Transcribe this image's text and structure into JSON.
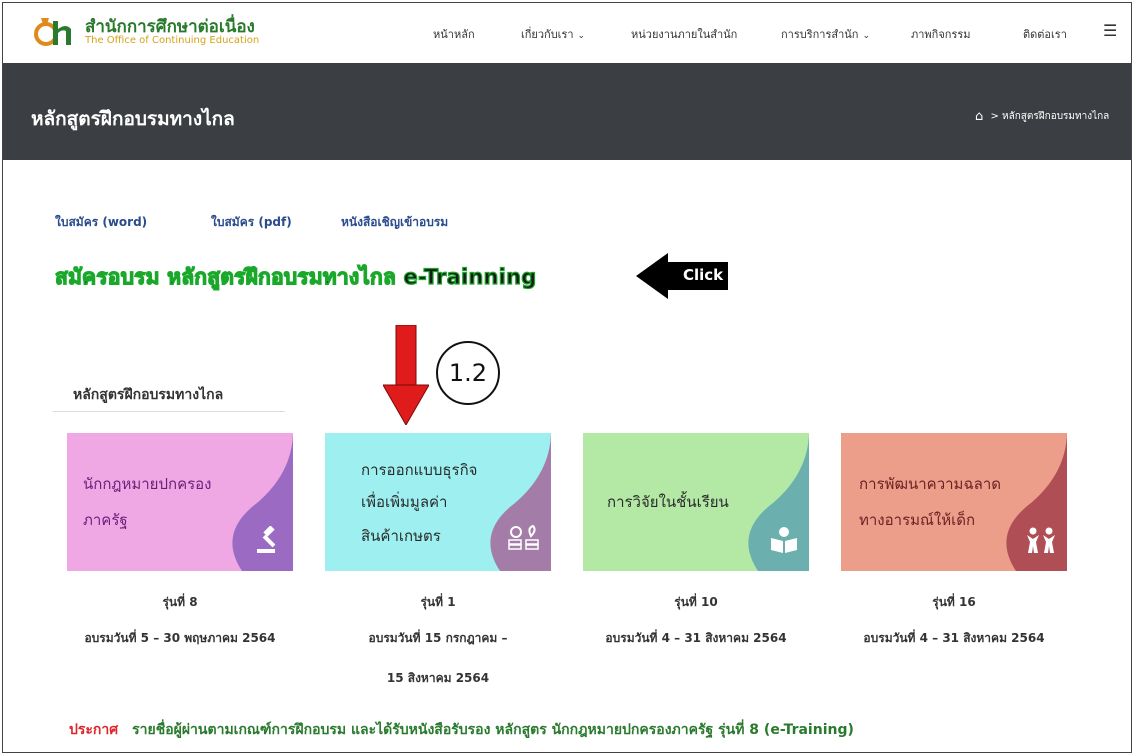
{
  "header": {
    "logo_th": "สำนักการศึกษาต่อเนื่อง",
    "logo_en": "The Office of Continuing Education",
    "nav": [
      {
        "label": "หน้าหลัก",
        "dropdown": false
      },
      {
        "label": "เกี่ยวกับเรา",
        "dropdown": true
      },
      {
        "label": "หน่วยงานภายในสำนัก",
        "dropdown": false
      },
      {
        "label": "การบริการสำนัก",
        "dropdown": true
      },
      {
        "label": "ภาพกิจกรรม",
        "dropdown": false
      },
      {
        "label": "ติดต่อเรา",
        "dropdown": false
      }
    ],
    "menu_icon": "hamburger-icon"
  },
  "banner": {
    "title": "หลักสูตรฝึกอบรมทางไกล",
    "breadcrumb_sep": ">",
    "breadcrumb_current": "หลักสูตรฝึกอบรมทางไกล"
  },
  "links": {
    "word": "ใบสมัคร (word)",
    "pdf": "ใบสมัคร (pdf)",
    "invite": "หนังสือเชิญเข้าอบรม"
  },
  "signup": {
    "text": "สมัครอบรม หลักสูตรฝึกอบรมทางไกล e-Trainning",
    "click_label": "Click"
  },
  "annotation": {
    "number": "1.2"
  },
  "section": {
    "title": "หลักสูตรฝึกอบรมทางไกล"
  },
  "courses": [
    {
      "lines": [
        "นักกฎหมายปกครอง",
        "ภาครัฐ"
      ],
      "icon": "gavel-icon",
      "generation": "รุ่นที่ 8",
      "dates": [
        "อบรมวันที่ 5 – 30 พฤษภาคม 2564"
      ],
      "bg": "#f0a8e4",
      "accent": "#9b6bc4",
      "text_color": "#6a1e7a"
    },
    {
      "lines": [
        "การออกแบบธุรกิจ",
        "เพื่อเพิ่มมูลค่า",
        "สินค้าเกษตร"
      ],
      "icon": "money-plant-icon",
      "generation": "รุ่นที่ 1",
      "dates": [
        "อบรมวันที่ 15 กรกฎาคม –",
        "15 สิงหาคม 2564"
      ],
      "bg": "#9ef0f0",
      "accent": "#a47ca8",
      "text_color": "#2b2b2b"
    },
    {
      "lines": [
        "การวิจัยในชั้นเรียน"
      ],
      "icon": "reading-icon",
      "generation": "รุ่นที่ 10",
      "dates": [
        "อบรมวันที่ 4 – 31 สิงหาคม 2564"
      ],
      "bg": "#b3e8a5",
      "accent": "#6bb0ae",
      "text_color": "#2b2b2b"
    },
    {
      "lines": [
        "การพัฒนาความฉลาด",
        "ทางอารมณ์ให้เด็ก"
      ],
      "icon": "children-icon",
      "generation": "รุ่นที่ 16",
      "dates": [
        "อบรมวันที่ 4 – 31 สิงหาคม 2564"
      ],
      "bg": "#ec9e8a",
      "accent": "#b04e55",
      "text_color": "#6a1f22"
    }
  ],
  "announcement": {
    "label": "ประกาศ",
    "text": "รายชื่อผู้ผ่านตามเกณฑ์การฝึกอบรม และได้รับหนังสือรับรอง หลักสูตร นักกฎหมายปกครองภาครัฐ รุ่นที่ 8 (e-Training)"
  },
  "colors": {
    "band": "#3b3e42",
    "link_blue": "#2a4b8c",
    "green": "#2a7a2e",
    "red": "#e0252a"
  }
}
